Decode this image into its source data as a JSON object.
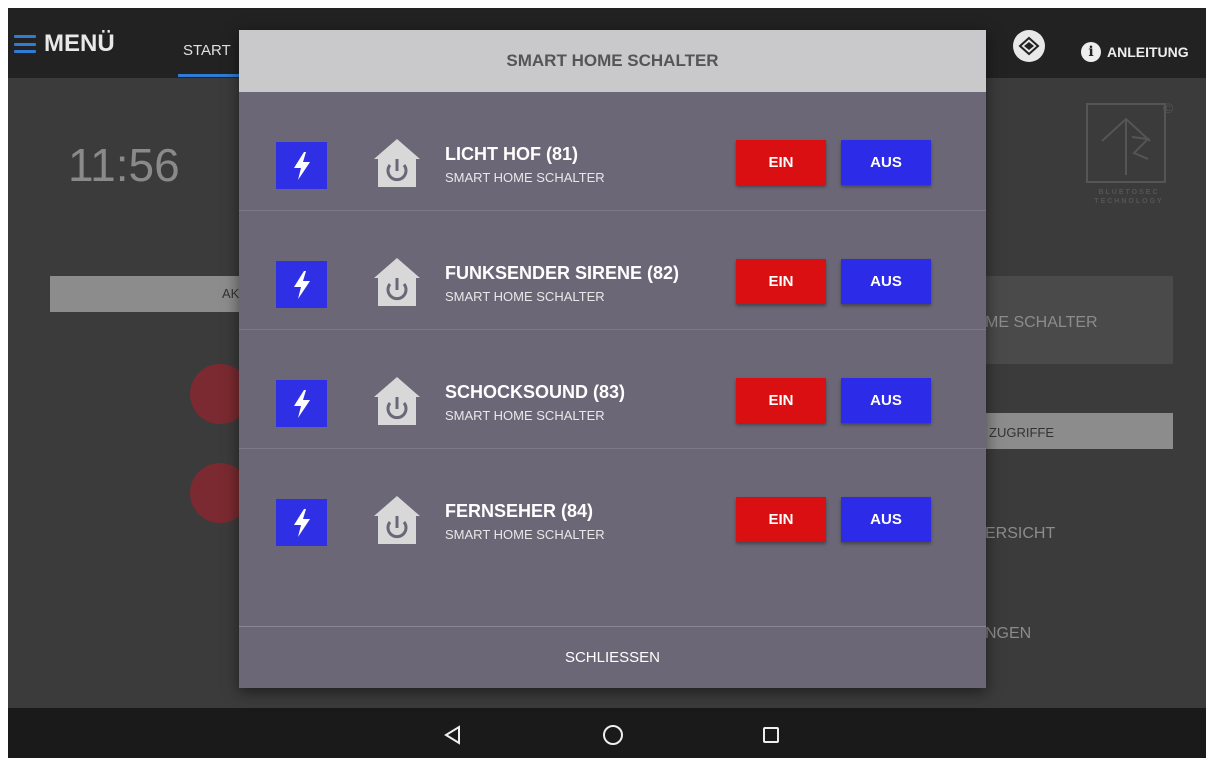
{
  "topbar": {
    "menu_label": "MENÜ",
    "start_tab": "START",
    "help_label": "ANLEITUNG"
  },
  "background": {
    "clock": "11:56",
    "left_bar_label": "AK",
    "right_panel_label": "ME SCHALTER",
    "right_bar_label": "ZUGRIFFE",
    "right_text_1": "ERSICHT",
    "right_text_2": "NGEN",
    "logo_line1": "BLUETOSEC",
    "logo_line2": "TECHNOLOGY",
    "logo_copyright": "©"
  },
  "dialog": {
    "title": "SMART HOME SCHALTER",
    "close_label": "SCHLIESSEN",
    "items": [
      {
        "title": "LICHT HOF (81)",
        "subtitle": "SMART HOME SCHALTER",
        "on_label": "EIN",
        "off_label": "AUS"
      },
      {
        "title": "FUNKSENDER SIRENE (82)",
        "subtitle": "SMART HOME SCHALTER",
        "on_label": "EIN",
        "off_label": "AUS"
      },
      {
        "title": "SCHOCKSOUND (83)",
        "subtitle": "SMART HOME SCHALTER",
        "on_label": "EIN",
        "off_label": "AUS"
      },
      {
        "title": "FERNSEHER (84)",
        "subtitle": "SMART HOME SCHALTER",
        "on_label": "EIN",
        "off_label": "AUS"
      }
    ]
  },
  "colors": {
    "on_button": "#d90f12",
    "off_button": "#2b2be8",
    "bolt_bg": "#2f2fe6",
    "dialog_bg": "#6b6777",
    "dialog_header_bg": "#c9c9cc"
  },
  "icons": {
    "menu": "hamburger-icon",
    "layers": "layers-icon",
    "info": "info-icon",
    "bolt": "lightning-bolt-icon",
    "device": "house-power-icon",
    "nav_back": "back-triangle-icon",
    "nav_home": "home-circle-icon",
    "nav_recents": "recents-square-icon"
  }
}
